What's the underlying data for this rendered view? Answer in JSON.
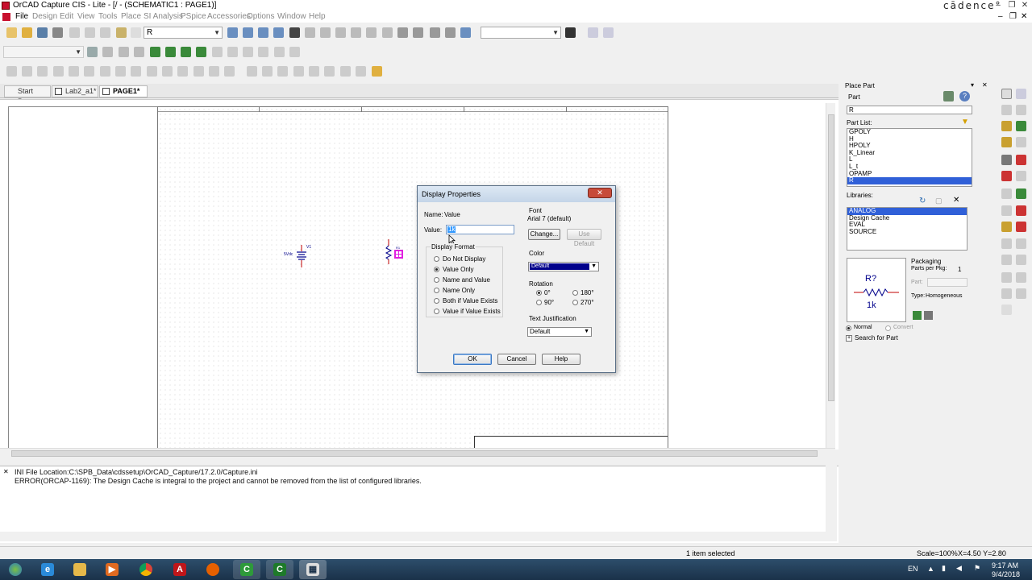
{
  "window": {
    "title": "OrCAD Capture CIS - Lite - [/ - (SCHEMATIC1 : PAGE1)]",
    "brand": "cādence°"
  },
  "menu": [
    "File",
    "Design",
    "Edit",
    "View",
    "Tools",
    "Place",
    "SI Analysis",
    "PSpice",
    "Accessories",
    "Options",
    "Window",
    "Help"
  ],
  "toolbar": {
    "search_value": "R",
    "find_value": "",
    "mode_value": ""
  },
  "tabs": [
    "Start Page",
    "Lab2_a1*",
    "PAGE1*"
  ],
  "schematic": {
    "source_label": "V1",
    "source_value": "5Vdc",
    "resistor_label": "R1"
  },
  "log": {
    "lines": [
      "INI File Location:C:\\SPB_Data\\cdssetup\\OrCAD_Capture/17.2.0/Capture.ini",
      "ERROR(ORCAP-1169): The Design Cache is integral to the project and cannot be removed from the list of configured libraries."
    ]
  },
  "status": {
    "selection": "1 item selected",
    "scale": "Scale=100%",
    "coords": "X=4.50  Y=2.80"
  },
  "taskbar": {
    "lang": "EN",
    "time": "9:17 AM",
    "date": "9/4/2018"
  },
  "place_part": {
    "header": "Place Part",
    "part_label": "Part",
    "part_value": "R",
    "part_list_label": "Part List:",
    "part_list": [
      "GPOLY",
      "H",
      "HPOLY",
      "K_Linear",
      "L",
      "L_t",
      "OPAMP",
      "R"
    ],
    "part_list_selected": 7,
    "libraries_label": "Libraries:",
    "libraries": [
      "ANALOG",
      "Design Cache",
      "EVAL",
      "SOURCE"
    ],
    "libraries_selected": 0,
    "preview_ref": "R?",
    "preview_value": "1k",
    "packaging_label": "Packaging",
    "parts_per_pkg_label": "Parts per Pkg:",
    "parts_per_pkg_value": "1",
    "part_field_label": "Part:",
    "type_label": "Type:",
    "type_value": "Homogeneous",
    "normal_label": "Normal",
    "convert_label": "Convert",
    "search_label": "Search for Part"
  },
  "dialog": {
    "title": "Display Properties",
    "name_label": "Name:",
    "name_value": "Value",
    "value_label": "Value:",
    "value_value": "1k",
    "display_format_label": "Display Format",
    "formats": [
      "Do Not Display",
      "Value Only",
      "Name and Value",
      "Name Only",
      "Both if Value Exists",
      "Value if Value Exists"
    ],
    "format_selected": 1,
    "font_label": "Font",
    "font_value": "Arial 7 (default)",
    "change_button": "Change...",
    "use_default_button": "Use Default",
    "color_label": "Color",
    "color_value": "Default",
    "color_swatch": "#00008b",
    "rotation_label": "Rotation",
    "rotations": [
      "0°",
      "90°",
      "180°",
      "270°"
    ],
    "rotation_selected": 0,
    "justification_label": "Text Justification",
    "justification_value": "Default",
    "ok_button": "OK",
    "cancel_button": "Cancel",
    "help_button": "Help"
  },
  "colors": {
    "selection": "#3060d8",
    "part_magenta": "#e020e0",
    "part_red": "#c00000"
  }
}
